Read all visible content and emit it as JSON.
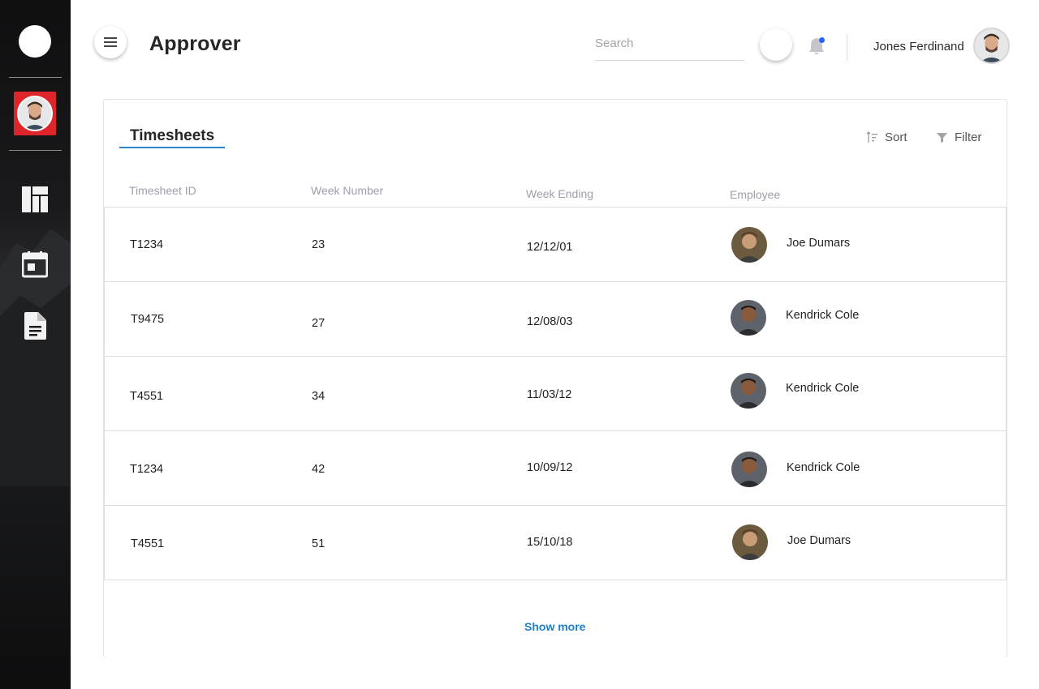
{
  "sidebar": {
    "items": [
      {
        "icon": "dashboard-icon"
      },
      {
        "icon": "calendar-icon"
      },
      {
        "icon": "document-icon"
      }
    ]
  },
  "header": {
    "title": "Approver",
    "search_placeholder": "Search",
    "search_value": "",
    "user_name": "Jones Ferdinand"
  },
  "card": {
    "tab_label": "Timesheets",
    "sort_label": "Sort",
    "filter_label": "Filter",
    "columns": [
      "Timesheet ID",
      "Week Number",
      "Week Ending",
      "Employee"
    ],
    "rows": [
      {
        "id": "T1234",
        "week": "23",
        "ending": "12/12/01",
        "employee": "Joe Dumars"
      },
      {
        "id": "T9475",
        "week": "27",
        "ending": "12/08/03",
        "employee": "Kendrick Cole"
      },
      {
        "id": "T4551",
        "week": "34",
        "ending": "11/03/12",
        "employee": "Kendrick Cole"
      },
      {
        "id": "T1234",
        "week": "42",
        "ending": "10/09/12",
        "employee": "Kendrick Cole"
      },
      {
        "id": "T4551",
        "week": "51",
        "ending": "15/10/18",
        "employee": "Joe Dumars"
      }
    ],
    "show_more_label": "Show more"
  },
  "colors": {
    "accent": "#1e7fc9",
    "tab_underline": "#2a87c9",
    "sidebar_active": "#e0242b",
    "notification_dot": "#2962ff"
  }
}
